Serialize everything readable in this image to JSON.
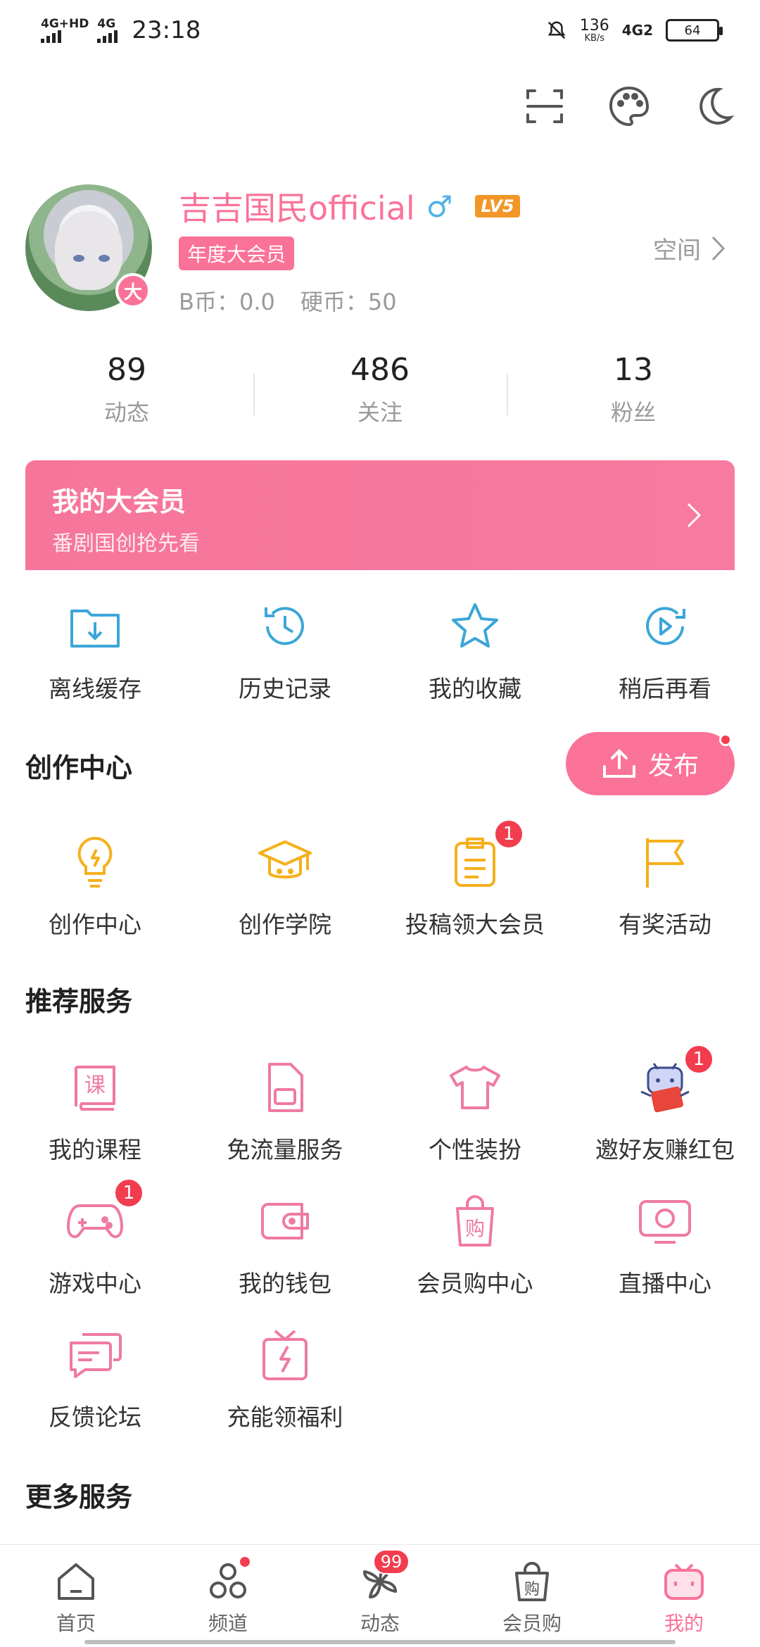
{
  "status_bar": {
    "network1": "4G+HD",
    "network2": "4G",
    "time": "23:18",
    "speed_value": "136",
    "speed_unit": "KB/s",
    "network3": "4G2",
    "battery": "64"
  },
  "top_icons": [
    "scan-icon",
    "palette-icon",
    "moon-icon"
  ],
  "profile": {
    "username": "吉吉国民official",
    "gender": "♂",
    "level": "LV5",
    "vip_tag": "年度大会员",
    "avatar_badge": "大",
    "bcoin": "B币：0.0",
    "coin": "硬币：50",
    "space_label": "空间"
  },
  "stats": [
    {
      "num": "89",
      "label": "动态"
    },
    {
      "num": "486",
      "label": "关注"
    },
    {
      "num": "13",
      "label": "粉丝"
    }
  ],
  "vip_banner": {
    "title": "我的大会员",
    "subtitle": "番剧国创抢先看"
  },
  "quick": [
    {
      "label": "离线缓存",
      "icon": "download-folder-icon"
    },
    {
      "label": "历史记录",
      "icon": "history-icon"
    },
    {
      "label": "我的收藏",
      "icon": "star-icon"
    },
    {
      "label": "稍后再看",
      "icon": "watch-later-icon"
    }
  ],
  "creation": {
    "title": "创作中心",
    "publish": "发布",
    "items": [
      {
        "label": "创作中心",
        "icon": "lightbulb-icon"
      },
      {
        "label": "创作学院",
        "icon": "graduation-cap-icon"
      },
      {
        "label": "投稿领大会员",
        "icon": "clipboard-icon",
        "badge": "1"
      },
      {
        "label": "有奖活动",
        "icon": "flag-icon"
      }
    ]
  },
  "services": {
    "title": "推荐服务",
    "row1": [
      {
        "label": "我的课程",
        "icon": "course-book-icon",
        "glyph": "课"
      },
      {
        "label": "免流量服务",
        "icon": "sim-card-icon"
      },
      {
        "label": "个性装扮",
        "icon": "tshirt-icon"
      },
      {
        "label": "邀好友赚红包",
        "icon": "mascot-red-envelope-icon",
        "badge": "1"
      }
    ],
    "row2": [
      {
        "label": "游戏中心",
        "icon": "gamepad-icon",
        "badge": "1"
      },
      {
        "label": "我的钱包",
        "icon": "wallet-icon"
      },
      {
        "label": "会员购中心",
        "icon": "shopping-bag-icon",
        "glyph": "购"
      },
      {
        "label": "直播中心",
        "icon": "tv-icon"
      }
    ],
    "row3": [
      {
        "label": "反馈论坛",
        "icon": "chat-bubbles-icon"
      },
      {
        "label": "充能领福利",
        "icon": "gift-charge-icon"
      }
    ]
  },
  "more_title": "更多服务",
  "bottom_nav": [
    {
      "label": "首页",
      "icon": "home-icon"
    },
    {
      "label": "频道",
      "icon": "channel-icon"
    },
    {
      "label": "动态",
      "icon": "pinwheel-icon",
      "badge": "99"
    },
    {
      "label": "会员购",
      "icon": "shop-bag-icon",
      "glyph": "购"
    },
    {
      "label": "我的",
      "icon": "tv-mascot-icon"
    }
  ],
  "colors": {
    "accent": "#fb7299",
    "blue_icon": "#3ba6d8",
    "yellow_icon": "#f5b01b",
    "badge_red": "#f23d4f"
  }
}
